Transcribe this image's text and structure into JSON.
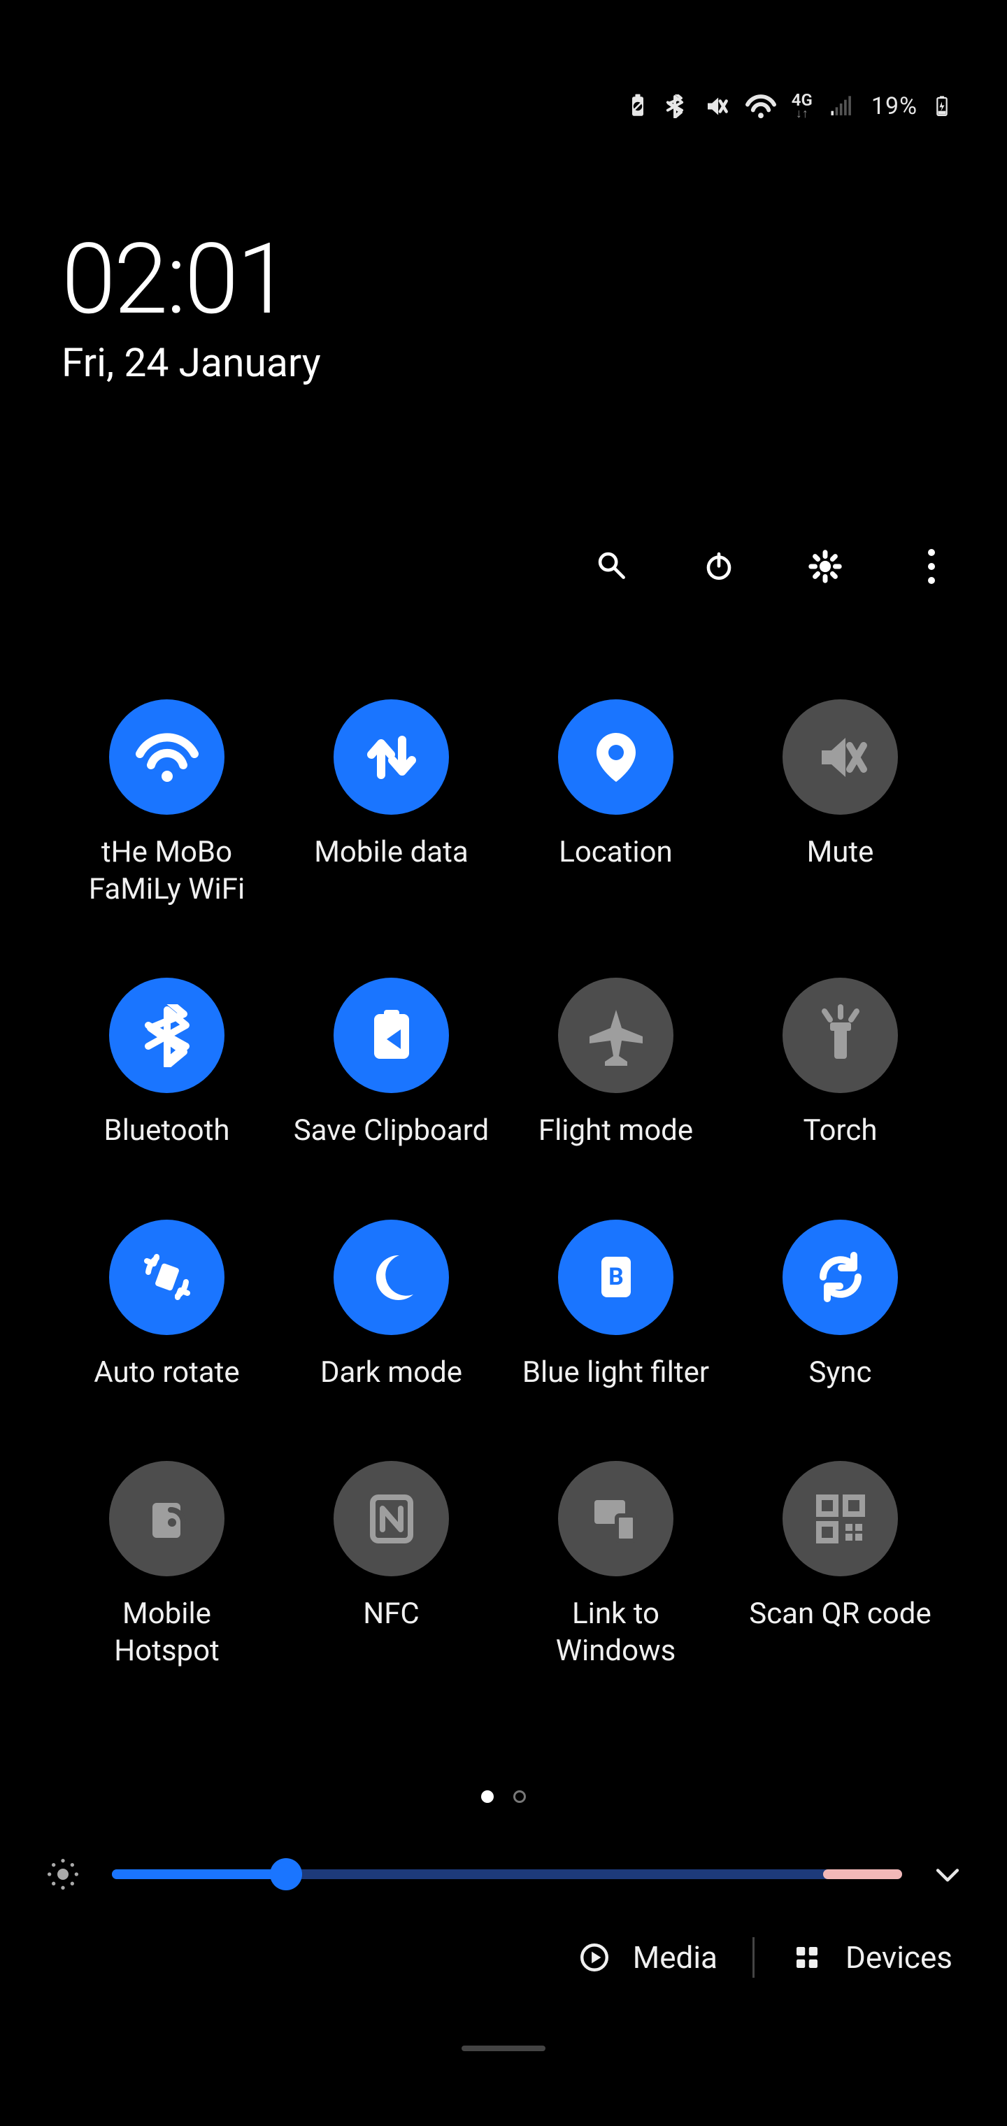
{
  "status_bar": {
    "network_label": "4G",
    "battery_percent": "19%"
  },
  "clock": {
    "time": "02:01",
    "date": "Fri, 24 January"
  },
  "brightness": {
    "percent": 22
  },
  "pagination": {
    "current": 1,
    "total": 2
  },
  "bottom_row": {
    "media_label": "Media",
    "devices_label": "Devices"
  },
  "tiles": [
    {
      "id": "wifi",
      "label": "tHe MoBo FaMiLy WiFi",
      "active": true,
      "icon": "wifi"
    },
    {
      "id": "mobile-data",
      "label": "Mobile data",
      "active": true,
      "icon": "updown"
    },
    {
      "id": "location",
      "label": "Location",
      "active": true,
      "icon": "location"
    },
    {
      "id": "mute",
      "label": "Mute",
      "active": false,
      "icon": "mute"
    },
    {
      "id": "bluetooth",
      "label": "Bluetooth",
      "active": true,
      "icon": "bluetooth"
    },
    {
      "id": "clipboard",
      "label": "Save Clipboard",
      "active": true,
      "icon": "clipboard"
    },
    {
      "id": "flight",
      "label": "Flight mode",
      "active": false,
      "icon": "plane"
    },
    {
      "id": "torch",
      "label": "Torch",
      "active": false,
      "icon": "torch"
    },
    {
      "id": "rotate",
      "label": "Auto rotate",
      "active": true,
      "icon": "rotate"
    },
    {
      "id": "dark",
      "label": "Dark mode",
      "active": true,
      "icon": "moon"
    },
    {
      "id": "bluelight",
      "label": "Blue light filter",
      "active": true,
      "icon": "bluelight"
    },
    {
      "id": "sync",
      "label": "Sync",
      "active": true,
      "icon": "sync"
    },
    {
      "id": "hotspot",
      "label": "Mobile Hotspot",
      "active": false,
      "icon": "hotspot"
    },
    {
      "id": "nfc",
      "label": "NFC",
      "active": false,
      "icon": "nfc"
    },
    {
      "id": "link",
      "label": "Link to Windows",
      "active": false,
      "icon": "link"
    },
    {
      "id": "qr",
      "label": "Scan QR code",
      "active": false,
      "icon": "qr"
    }
  ]
}
